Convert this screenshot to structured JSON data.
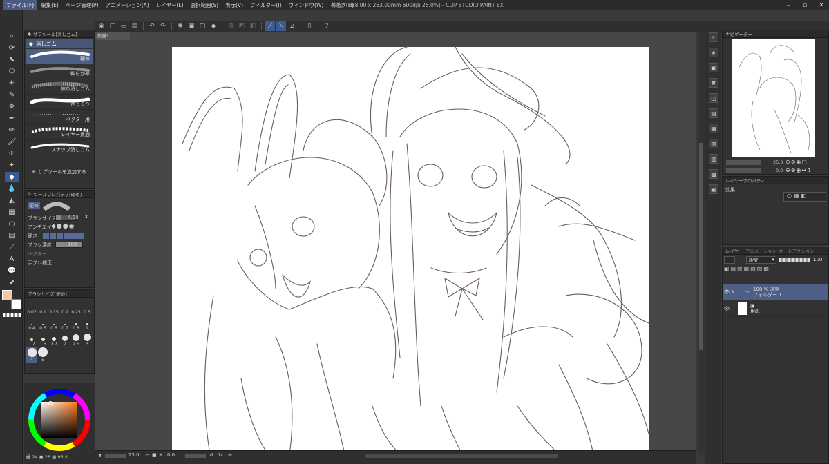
{
  "app": {
    "window_title": "熊猫* (188.00 x 263.00mm 600dpi 25.0%) - CLIP STUDIO PAINT EX",
    "menu": [
      "ファイル(F)",
      "編集(E)",
      "ページ管理(P)",
      "アニメーション(A)",
      "レイヤー(L)",
      "選択範囲(S)",
      "表示(V)",
      "フィルター(I)",
      "ウィンドウ(W)",
      "ヘルプ(H)"
    ]
  },
  "subtool_panel": {
    "header": "サブツール[消しゴム]",
    "tab_label": "消しゴム",
    "items": [
      {
        "label": "硬め"
      },
      {
        "label": "軟らかめ"
      },
      {
        "label": "練り消しゴム"
      },
      {
        "label": "ざっくり"
      },
      {
        "label": "ベクター用"
      },
      {
        "label": "レイヤー貫通"
      },
      {
        "label": "スナップ消しゴム"
      }
    ],
    "add_label": "サブツールを追加する"
  },
  "tool_property": {
    "header": "ツールプロパティ[硬め]",
    "preset_label": "硬め",
    "brush_size_label": "ブラシサイズ",
    "brush_size_value": "4.00",
    "antialias_label": "アンチエイ",
    "hardness_label": "硬さ",
    "density_label": "ブラシ濃度",
    "density_value": "100",
    "vector_label": "ベクター",
    "stabilize_label": "手ブレ補正"
  },
  "brush_size_panel": {
    "header": "ブラシサイズ[硬め]",
    "sizes": [
      "0.07",
      "0.1",
      "0.15",
      "0.2",
      "0.25",
      "0.3",
      "0.4",
      "0.5",
      "0.6",
      "0.7",
      "0.8",
      "1",
      "1.2",
      "1.5",
      "1.7",
      "2",
      "2.5",
      "3",
      "4",
      "5"
    ],
    "selected": "4"
  },
  "canvas": {
    "tab_label": "熊猫*"
  },
  "status": {
    "zoom": "25.0",
    "rotation": "0.0",
    "page_values": [
      "24",
      "26",
      "96"
    ]
  },
  "navigator": {
    "header": "ナビゲーター",
    "zoom": "25.0",
    "rotation": "0.0"
  },
  "layer_property": {
    "header": "レイヤープロパティ",
    "effect_label": "効果"
  },
  "layers": {
    "header": "レイヤー",
    "tab2": "アニメーション",
    "tab3": "オートアクション",
    "blend_mode": "通常",
    "opacity": "100",
    "items": [
      {
        "line1": "100 % 通常",
        "line2": "フォルダー 1",
        "selected": true
      },
      {
        "line1": "",
        "line2": "用紙",
        "selected": false
      }
    ]
  },
  "colors": {
    "main_color": "#f2c8a8",
    "sub_color": "#ffffff",
    "accent": "#4e5f86"
  }
}
